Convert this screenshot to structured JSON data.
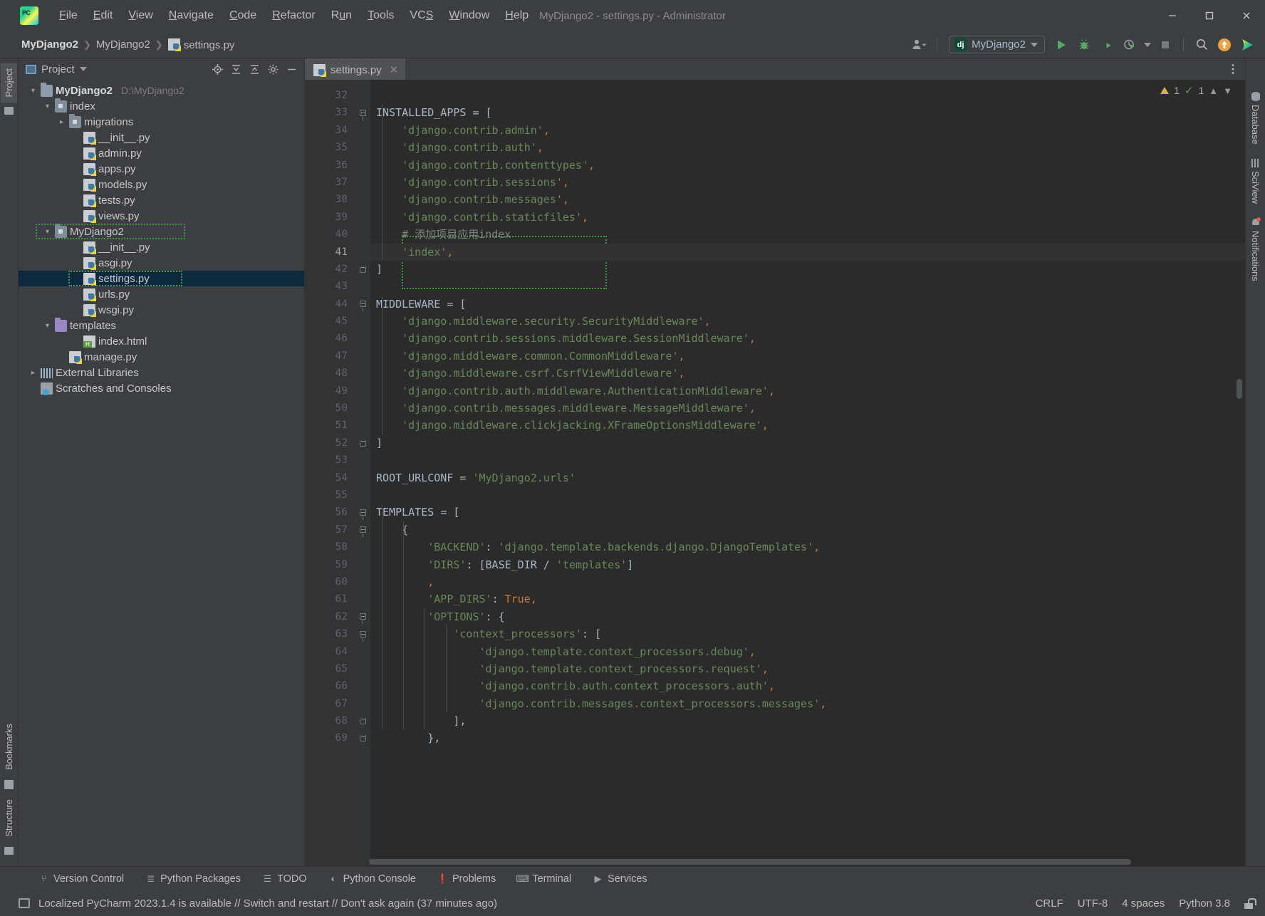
{
  "window": {
    "title": "MyDjango2 - settings.py - Administrator",
    "minimize": "–",
    "maximize": "☐",
    "close": "✕"
  },
  "menu": [
    {
      "label": "File"
    },
    {
      "label": "Edit"
    },
    {
      "label": "View"
    },
    {
      "label": "Navigate"
    },
    {
      "label": "Code"
    },
    {
      "label": "Refactor"
    },
    {
      "label": "Run"
    },
    {
      "label": "Tools"
    },
    {
      "label": "VCS"
    },
    {
      "label": "Window"
    },
    {
      "label": "Help"
    }
  ],
  "breadcrumb": {
    "items": [
      "MyDjango2",
      "MyDjango2",
      "settings.py"
    ],
    "separator": "❯"
  },
  "toolbar": {
    "run_config": "MyDjango2",
    "run_config_badge": "dj",
    "icons": [
      {
        "name": "user-account-icon",
        "glyph": "●"
      },
      {
        "name": "run-icon",
        "glyph": "▶"
      },
      {
        "name": "debug-icon",
        "glyph": "◉"
      },
      {
        "name": "run-coverage-icon",
        "glyph": "◑"
      },
      {
        "name": "profiler-icon",
        "glyph": "◴"
      },
      {
        "name": "stop-icon",
        "glyph": "■"
      },
      {
        "name": "search-icon",
        "glyph": "⌕"
      },
      {
        "name": "update-project-icon",
        "glyph": "↑"
      },
      {
        "name": "ai-assistant-icon",
        "glyph": "▶"
      }
    ]
  },
  "left_strip": {
    "tabs": [
      {
        "label": "Project",
        "active": true
      }
    ],
    "bottom_tabs": [
      {
        "label": "Bookmarks"
      },
      {
        "label": "Structure"
      }
    ]
  },
  "project_panel": {
    "title": "Project",
    "actions": [
      "target-icon",
      "expand-all-icon",
      "collapse-all-icon",
      "settings-gear-icon",
      "hide-icon"
    ],
    "tree": [
      {
        "indent": 0,
        "arrow": "down",
        "icon": "folder",
        "label": "MyDjango2",
        "bold": true,
        "sub": "D:\\MyDjango2"
      },
      {
        "indent": 1,
        "arrow": "down",
        "icon": "folder-src",
        "label": "index"
      },
      {
        "indent": 2,
        "arrow": "right",
        "icon": "folder-src",
        "label": "migrations"
      },
      {
        "indent": 3,
        "arrow": "none",
        "icon": "py",
        "label": "__init__.py"
      },
      {
        "indent": 3,
        "arrow": "none",
        "icon": "py",
        "label": "admin.py"
      },
      {
        "indent": 3,
        "arrow": "none",
        "icon": "py",
        "label": "apps.py"
      },
      {
        "indent": 3,
        "arrow": "none",
        "icon": "py",
        "label": "models.py"
      },
      {
        "indent": 3,
        "arrow": "none",
        "icon": "py",
        "label": "tests.py"
      },
      {
        "indent": 3,
        "arrow": "none",
        "icon": "py",
        "label": "views.py"
      },
      {
        "indent": 1,
        "arrow": "down",
        "icon": "folder-src",
        "label": "MyDjango2",
        "annotated": true
      },
      {
        "indent": 3,
        "arrow": "none",
        "icon": "py",
        "label": "__init__.py"
      },
      {
        "indent": 3,
        "arrow": "none",
        "icon": "py",
        "label": "asgi.py"
      },
      {
        "indent": 3,
        "arrow": "none",
        "icon": "py",
        "label": "settings.py",
        "selected": true,
        "annotated": true
      },
      {
        "indent": 3,
        "arrow": "none",
        "icon": "py",
        "label": "urls.py"
      },
      {
        "indent": 3,
        "arrow": "none",
        "icon": "py",
        "label": "wsgi.py"
      },
      {
        "indent": 1,
        "arrow": "down",
        "icon": "folder-purple",
        "label": "templates"
      },
      {
        "indent": 3,
        "arrow": "none",
        "icon": "html",
        "label": "index.html"
      },
      {
        "indent": 2,
        "arrow": "none",
        "icon": "py",
        "label": "manage.py"
      },
      {
        "indent": 0,
        "arrow": "right",
        "icon": "lib",
        "label": "External Libraries"
      },
      {
        "indent": 0,
        "arrow": "none",
        "icon": "scratch",
        "label": "Scratches and Consoles"
      }
    ]
  },
  "editor": {
    "tab": {
      "label": "settings.py",
      "close": "✕"
    },
    "inspection": {
      "warnings": "1",
      "checks": "1"
    },
    "first_line_number": 32,
    "current_line": 41,
    "lines": [
      {
        "n": 32,
        "tokens": []
      },
      {
        "n": 33,
        "fold": "open",
        "tokens": [
          {
            "t": "var",
            "s": "INSTALLED_APPS "
          },
          {
            "t": "pun",
            "s": "= ["
          }
        ]
      },
      {
        "n": 34,
        "tokens": [
          {
            "t": "sp",
            "s": "    "
          },
          {
            "t": "str",
            "s": "'django.contrib.admin'"
          },
          {
            "t": "comma",
            "s": ","
          }
        ]
      },
      {
        "n": 35,
        "tokens": [
          {
            "t": "sp",
            "s": "    "
          },
          {
            "t": "str",
            "s": "'django.contrib.auth'"
          },
          {
            "t": "comma",
            "s": ","
          }
        ]
      },
      {
        "n": 36,
        "tokens": [
          {
            "t": "sp",
            "s": "    "
          },
          {
            "t": "str",
            "s": "'django.contrib.contenttypes'"
          },
          {
            "t": "comma",
            "s": ","
          }
        ]
      },
      {
        "n": 37,
        "tokens": [
          {
            "t": "sp",
            "s": "    "
          },
          {
            "t": "str",
            "s": "'django.contrib.sessions'"
          },
          {
            "t": "comma",
            "s": ","
          }
        ]
      },
      {
        "n": 38,
        "tokens": [
          {
            "t": "sp",
            "s": "    "
          },
          {
            "t": "str",
            "s": "'django.contrib.messages'"
          },
          {
            "t": "comma",
            "s": ","
          }
        ]
      },
      {
        "n": 39,
        "tokens": [
          {
            "t": "sp",
            "s": "    "
          },
          {
            "t": "str",
            "s": "'django.contrib.staticfiles'"
          },
          {
            "t": "comma",
            "s": ","
          }
        ]
      },
      {
        "n": 40,
        "tokens": [
          {
            "t": "sp",
            "s": "    "
          },
          {
            "t": "cmt",
            "s": "# 添加项目应用index"
          }
        ]
      },
      {
        "n": 41,
        "current": true,
        "tokens": [
          {
            "t": "sp",
            "s": "    "
          },
          {
            "t": "str",
            "s": "'index'"
          },
          {
            "t": "comma",
            "s": ","
          }
        ]
      },
      {
        "n": 42,
        "fold": "close",
        "tokens": [
          {
            "t": "pun",
            "s": "]"
          }
        ]
      },
      {
        "n": 43,
        "tokens": []
      },
      {
        "n": 44,
        "fold": "open",
        "tokens": [
          {
            "t": "var",
            "s": "MIDDLEWARE "
          },
          {
            "t": "pun",
            "s": "= ["
          }
        ]
      },
      {
        "n": 45,
        "tokens": [
          {
            "t": "sp",
            "s": "    "
          },
          {
            "t": "str",
            "s": "'django.middleware.security.SecurityMiddleware'"
          },
          {
            "t": "comma",
            "s": ","
          }
        ]
      },
      {
        "n": 46,
        "tokens": [
          {
            "t": "sp",
            "s": "    "
          },
          {
            "t": "str",
            "s": "'django.contrib.sessions.middleware.SessionMiddleware'"
          },
          {
            "t": "comma",
            "s": ","
          }
        ]
      },
      {
        "n": 47,
        "tokens": [
          {
            "t": "sp",
            "s": "    "
          },
          {
            "t": "str",
            "s": "'django.middleware.common.CommonMiddleware'"
          },
          {
            "t": "comma",
            "s": ","
          }
        ]
      },
      {
        "n": 48,
        "tokens": [
          {
            "t": "sp",
            "s": "    "
          },
          {
            "t": "str",
            "s": "'django.middleware.csrf.CsrfViewMiddleware'"
          },
          {
            "t": "comma",
            "s": ","
          }
        ]
      },
      {
        "n": 49,
        "tokens": [
          {
            "t": "sp",
            "s": "    "
          },
          {
            "t": "str",
            "s": "'django.contrib.auth.middleware.AuthenticationMiddleware'"
          },
          {
            "t": "comma",
            "s": ","
          }
        ]
      },
      {
        "n": 50,
        "tokens": [
          {
            "t": "sp",
            "s": "    "
          },
          {
            "t": "str",
            "s": "'django.contrib.messages.middleware.MessageMiddleware'"
          },
          {
            "t": "comma",
            "s": ","
          }
        ]
      },
      {
        "n": 51,
        "tokens": [
          {
            "t": "sp",
            "s": "    "
          },
          {
            "t": "str",
            "s": "'django.middleware.clickjacking.XFrameOptionsMiddleware'"
          },
          {
            "t": "comma",
            "s": ","
          }
        ]
      },
      {
        "n": 52,
        "fold": "close",
        "tokens": [
          {
            "t": "pun",
            "s": "]"
          }
        ]
      },
      {
        "n": 53,
        "tokens": []
      },
      {
        "n": 54,
        "tokens": [
          {
            "t": "var",
            "s": "ROOT_URLCONF "
          },
          {
            "t": "pun",
            "s": "= "
          },
          {
            "t": "str",
            "s": "'MyDjango2.urls'"
          }
        ]
      },
      {
        "n": 55,
        "tokens": []
      },
      {
        "n": 56,
        "fold": "open",
        "tokens": [
          {
            "t": "var",
            "s": "TEMPLATES "
          },
          {
            "t": "pun",
            "s": "= ["
          }
        ]
      },
      {
        "n": 57,
        "fold": "open2",
        "tokens": [
          {
            "t": "sp",
            "s": "    "
          },
          {
            "t": "pun",
            "s": "{"
          }
        ]
      },
      {
        "n": 58,
        "tokens": [
          {
            "t": "sp",
            "s": "        "
          },
          {
            "t": "str",
            "s": "'BACKEND'"
          },
          {
            "t": "pun",
            "s": ": "
          },
          {
            "t": "str",
            "s": "'django.template.backends.django.DjangoTemplates'"
          },
          {
            "t": "comma",
            "s": ","
          }
        ]
      },
      {
        "n": 59,
        "tokens": [
          {
            "t": "sp",
            "s": "        "
          },
          {
            "t": "str",
            "s": "'DIRS'"
          },
          {
            "t": "pun",
            "s": ": ["
          },
          {
            "t": "var",
            "s": "BASE_DIR"
          },
          {
            "t": "pun",
            "s": " / "
          },
          {
            "t": "str",
            "s": "'templates'"
          },
          {
            "t": "pun",
            "s": "]"
          }
        ]
      },
      {
        "n": 60,
        "tokens": [
          {
            "t": "sp",
            "s": "        "
          },
          {
            "t": "comma",
            "s": ","
          }
        ]
      },
      {
        "n": 61,
        "tokens": [
          {
            "t": "sp",
            "s": "        "
          },
          {
            "t": "str",
            "s": "'APP_DIRS'"
          },
          {
            "t": "pun",
            "s": ": "
          },
          {
            "t": "key",
            "s": "True"
          },
          {
            "t": "comma",
            "s": ","
          }
        ]
      },
      {
        "n": 62,
        "fold": "open3",
        "tokens": [
          {
            "t": "sp",
            "s": "        "
          },
          {
            "t": "str",
            "s": "'OPTIONS'"
          },
          {
            "t": "pun",
            "s": ": {"
          }
        ]
      },
      {
        "n": 63,
        "fold": "open4",
        "tokens": [
          {
            "t": "sp",
            "s": "            "
          },
          {
            "t": "str",
            "s": "'context_processors'"
          },
          {
            "t": "pun",
            "s": ": ["
          }
        ]
      },
      {
        "n": 64,
        "tokens": [
          {
            "t": "sp",
            "s": "                "
          },
          {
            "t": "str",
            "s": "'django.template.context_processors.debug'"
          },
          {
            "t": "comma",
            "s": ","
          }
        ]
      },
      {
        "n": 65,
        "tokens": [
          {
            "t": "sp",
            "s": "                "
          },
          {
            "t": "str",
            "s": "'django.template.context_processors.request'"
          },
          {
            "t": "comma",
            "s": ","
          }
        ]
      },
      {
        "n": 66,
        "tokens": [
          {
            "t": "sp",
            "s": "                "
          },
          {
            "t": "str",
            "s": "'django.contrib.auth.context_processors.auth'"
          },
          {
            "t": "comma",
            "s": ","
          }
        ]
      },
      {
        "n": 67,
        "tokens": [
          {
            "t": "sp",
            "s": "                "
          },
          {
            "t": "str",
            "s": "'django.contrib.messages.context_processors.messages'"
          },
          {
            "t": "comma",
            "s": ","
          }
        ]
      },
      {
        "n": 68,
        "fold": "close2",
        "tokens": [
          {
            "t": "sp",
            "s": "            "
          },
          {
            "t": "pun",
            "s": "],"
          }
        ]
      },
      {
        "n": 69,
        "fold": "close3",
        "tokens": [
          {
            "t": "sp",
            "s": "        "
          },
          {
            "t": "pun",
            "s": "},"
          }
        ]
      }
    ]
  },
  "right_strip": {
    "tabs": [
      {
        "label": "Database",
        "icon": "database-icon"
      },
      {
        "label": "SciView",
        "icon": "sciview-icon"
      },
      {
        "label": "Notifications",
        "icon": "bell-icon"
      }
    ]
  },
  "bottom_tools": [
    {
      "label": "Version Control",
      "icon": "branch-icon",
      "glyph": "⑂"
    },
    {
      "label": "Python Packages",
      "icon": "packages-icon",
      "glyph": "≣"
    },
    {
      "label": "TODO",
      "icon": "todo-icon",
      "glyph": "☰"
    },
    {
      "label": "Python Console",
      "icon": "python-icon",
      "glyph": "◐"
    },
    {
      "label": "Problems",
      "icon": "problems-icon",
      "glyph": "❗"
    },
    {
      "label": "Terminal",
      "icon": "terminal-icon",
      "glyph": "⌨"
    },
    {
      "label": "Services",
      "icon": "services-icon",
      "glyph": "▶"
    }
  ],
  "status": {
    "message": "Localized PyCharm 2023.1.4 is available // Switch and restart // Don't ask again (37 minutes ago)",
    "right": [
      "CRLF",
      "UTF-8",
      "4 spaces",
      "Python 3.8"
    ]
  }
}
